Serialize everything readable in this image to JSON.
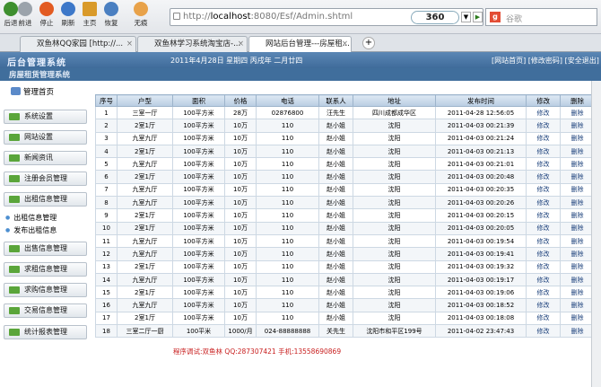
{
  "toolbar": {
    "buttons": [
      {
        "label": "后退",
        "icon": "back-icon"
      },
      {
        "label": "前进",
        "icon": "forward-icon"
      },
      {
        "label": "停止",
        "icon": "stop-icon"
      },
      {
        "label": "刷新",
        "icon": "refresh-icon"
      },
      {
        "label": "主页",
        "icon": "home-icon"
      },
      {
        "label": "恢复",
        "icon": "undo-icon"
      },
      {
        "label": "无痕",
        "icon": "incognito-icon"
      }
    ],
    "address_host": "http://",
    "address_main": "localhost",
    "address_rest": ":8080/Esf/Admin.shtml",
    "brand": "360",
    "search_placeholder": "谷歌"
  },
  "tabs": [
    {
      "label": "双鱼林QQ家园 [http://..."
    },
    {
      "label": "双鱼林学习系统淘宝店-..."
    },
    {
      "label": "网站后台管理---房屋租..."
    }
  ],
  "header": {
    "title": "后台管理系统",
    "date": "2011年4月28日  星期四  丙戌年 二月廿四",
    "links": "[网站首页] [修改密码] [安全退出]"
  },
  "subheader": {
    "title": "房屋租赁管理系统"
  },
  "sidebar": {
    "home": "管理首页",
    "buttons_top": [
      "系统设置",
      "网站设置",
      "新闻资讯",
      "注册会员管理",
      "出租信息管理"
    ],
    "plain": [
      "出租信息管理",
      "发布出租信息"
    ],
    "buttons_bottom": [
      "出售信息管理",
      "求租信息管理",
      "求购信息管理",
      "交易信息管理",
      "统计报表管理"
    ]
  },
  "table": {
    "headers": [
      "序号",
      "户型",
      "面积",
      "价格",
      "电话",
      "联系人",
      "地址",
      "发布时间",
      "修改",
      "删除"
    ],
    "rows": [
      [
        "1",
        "三室一厅",
        "100平方米",
        "28万",
        "02876800",
        "汪先生",
        "四川成都成华区",
        "2011-04-28 12:56:05",
        "修改",
        "删除"
      ],
      [
        "2",
        "2室1厅",
        "100平方米",
        "10万",
        "110",
        "赵小姐",
        "沈阳",
        "2011-04-03 00:21:39",
        "修改",
        "删除"
      ],
      [
        "3",
        "九室九厅",
        "100平方米",
        "10万",
        "110",
        "赵小姐",
        "沈阳",
        "2011-04-03 00:21:24",
        "修改",
        "删除"
      ],
      [
        "4",
        "2室1厅",
        "100平方米",
        "10万",
        "110",
        "赵小姐",
        "沈阳",
        "2011-04-03 00:21:13",
        "修改",
        "删除"
      ],
      [
        "5",
        "九室九厅",
        "100平方米",
        "10万",
        "110",
        "赵小姐",
        "沈阳",
        "2011-04-03 00:21:01",
        "修改",
        "删除"
      ],
      [
        "6",
        "2室1厅",
        "100平方米",
        "10万",
        "110",
        "赵小姐",
        "沈阳",
        "2011-04-03 00:20:48",
        "修改",
        "删除"
      ],
      [
        "7",
        "九室九厅",
        "100平方米",
        "10万",
        "110",
        "赵小姐",
        "沈阳",
        "2011-04-03 00:20:35",
        "修改",
        "删除"
      ],
      [
        "8",
        "九室九厅",
        "100平方米",
        "10万",
        "110",
        "赵小姐",
        "沈阳",
        "2011-04-03 00:20:26",
        "修改",
        "删除"
      ],
      [
        "9",
        "2室1厅",
        "100平方米",
        "10万",
        "110",
        "赵小姐",
        "沈阳",
        "2011-04-03 00:20:15",
        "修改",
        "删除"
      ],
      [
        "10",
        "2室1厅",
        "100平方米",
        "10万",
        "110",
        "赵小姐",
        "沈阳",
        "2011-04-03 00:20:05",
        "修改",
        "删除"
      ],
      [
        "11",
        "九室九厅",
        "100平方米",
        "10万",
        "110",
        "赵小姐",
        "沈阳",
        "2011-04-03 00:19:54",
        "修改",
        "删除"
      ],
      [
        "12",
        "九室九厅",
        "100平方米",
        "10万",
        "110",
        "赵小姐",
        "沈阳",
        "2011-04-03 00:19:41",
        "修改",
        "删除"
      ],
      [
        "13",
        "2室1厅",
        "100平方米",
        "10万",
        "110",
        "赵小姐",
        "沈阳",
        "2011-04-03 00:19:32",
        "修改",
        "删除"
      ],
      [
        "14",
        "九室九厅",
        "100平方米",
        "10万",
        "110",
        "赵小姐",
        "沈阳",
        "2011-04-03 00:19:17",
        "修改",
        "删除"
      ],
      [
        "15",
        "2室1厅",
        "100平方米",
        "10万",
        "110",
        "赵小姐",
        "沈阳",
        "2011-04-03 00:19:06",
        "修改",
        "删除"
      ],
      [
        "16",
        "九室九厅",
        "100平方米",
        "10万",
        "110",
        "赵小姐",
        "沈阳",
        "2011-04-03 00:18:52",
        "修改",
        "删除"
      ],
      [
        "17",
        "2室1厅",
        "100平方米",
        "10万",
        "110",
        "赵小姐",
        "沈阳",
        "2011-04-03 00:18:08",
        "修改",
        "删除"
      ],
      [
        "18",
        "三室二厅一厨",
        "100平米",
        "1000/月",
        "024-88888888",
        "关先生",
        "沈阳市和平区199号",
        "2011-04-02 23:47:43",
        "修改",
        "删除"
      ]
    ]
  },
  "footer": "程序调试:双鱼林  QQ:287307421 手机:13558690869",
  "colors": {
    "header": "#3f6b9a",
    "accent": "#5aa53a",
    "footer_text": "#c81e1e"
  }
}
